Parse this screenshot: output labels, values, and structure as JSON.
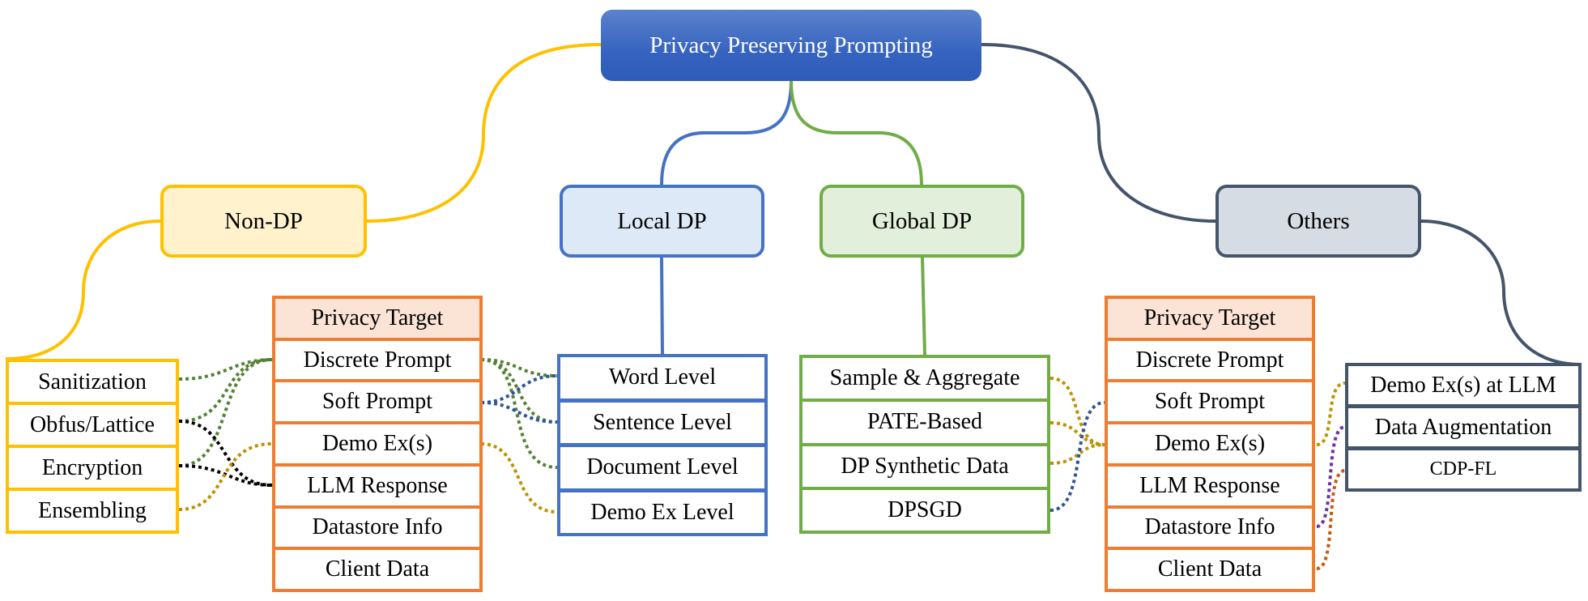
{
  "title": "Privacy Preserving Prompting",
  "colors": {
    "root": "#3563bf",
    "non_dp": "#ffc000",
    "local_dp": "#4472c4",
    "global_dp": "#70ad47",
    "others": "#44546a",
    "privacy_target": "#ed7d31",
    "link_green": "#548235",
    "link_blue": "#2f5597",
    "link_black": "#000000",
    "link_gold": "#bf9000",
    "link_purple": "#7030a0",
    "link_orange": "#c55a11"
  },
  "categories": {
    "non_dp": {
      "label": "Non-DP",
      "items": [
        "Sanitization",
        "Obfus/Lattice",
        "Encryption",
        "Ensembling"
      ]
    },
    "local_dp": {
      "label": "Local DP",
      "items": [
        "Word Level",
        "Sentence Level",
        "Document Level",
        "Demo Ex Level"
      ]
    },
    "global_dp": {
      "label": "Global DP",
      "items": [
        "Sample & Aggregate",
        "PATE-Based",
        "DP Synthetic Data",
        "DPSGD"
      ]
    },
    "others": {
      "label": "Others",
      "items": [
        "Demo Ex(s) at LLM",
        "Data Augmentation",
        "CDP-FL"
      ]
    }
  },
  "privacy_target_left": {
    "header": "Privacy Target",
    "items": [
      "Discrete Prompt",
      "Soft Prompt",
      "Demo Ex(s)",
      "LLM Response",
      "Datastore Info",
      "Client Data"
    ]
  },
  "privacy_target_right": {
    "header": "Privacy Target",
    "items": [
      "Discrete Prompt",
      "Soft Prompt",
      "Demo Ex(s)",
      "LLM Response",
      "Datastore Info",
      "Client Data"
    ]
  },
  "links": [
    {
      "from": "Sanitization",
      "to": "Discrete Prompt (left)",
      "color": "green"
    },
    {
      "from": "Obfus/Lattice",
      "to": "Discrete Prompt (left)",
      "color": "green"
    },
    {
      "from": "Encryption",
      "to": "Discrete Prompt (left)",
      "color": "green"
    },
    {
      "from": "Obfus/Lattice",
      "to": "LLM Response (left)",
      "color": "black"
    },
    {
      "from": "Encryption",
      "to": "LLM Response (left)",
      "color": "black"
    },
    {
      "from": "Ensembling",
      "to": "Demo Ex(s) (left)",
      "color": "gold"
    },
    {
      "from": "Discrete Prompt (left)",
      "to": "Word Level",
      "color": "green"
    },
    {
      "from": "Discrete Prompt (left)",
      "to": "Sentence Level",
      "color": "green"
    },
    {
      "from": "Discrete Prompt (left)",
      "to": "Document Level",
      "color": "green"
    },
    {
      "from": "Soft Prompt (left)",
      "to": "Word Level",
      "color": "blue"
    },
    {
      "from": "Soft Prompt (left)",
      "to": "Sentence Level",
      "color": "blue"
    },
    {
      "from": "Demo Ex(s) (left)",
      "to": "Demo Ex Level",
      "color": "gold"
    },
    {
      "from": "Sample & Aggregate",
      "to": "Demo Ex(s) (right)",
      "color": "gold"
    },
    {
      "from": "PATE-Based",
      "to": "Demo Ex(s) (right)",
      "color": "gold"
    },
    {
      "from": "DP Synthetic Data",
      "to": "Demo Ex(s) (right)",
      "color": "gold"
    },
    {
      "from": "DPSGD",
      "to": "Soft Prompt (right)",
      "color": "blue"
    },
    {
      "from": "Demo Ex(s) (right)",
      "to": "Demo Ex(s) at LLM",
      "color": "gold"
    },
    {
      "from": "Datastore Info (right)",
      "to": "Data Augmentation",
      "color": "purple"
    },
    {
      "from": "Client Data (right)",
      "to": "CDP-FL",
      "color": "orange"
    }
  ]
}
